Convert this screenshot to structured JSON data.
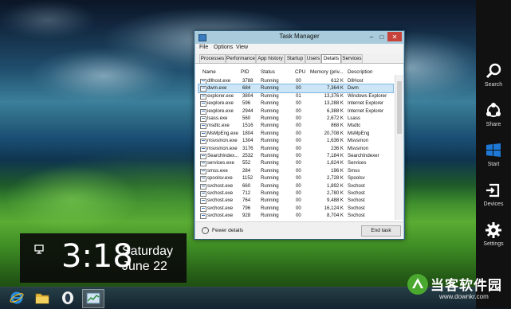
{
  "task_manager": {
    "title": "Task Manager",
    "menu": [
      "File",
      "Options",
      "View"
    ],
    "tabs": [
      {
        "label": "Processes",
        "selected": false
      },
      {
        "label": "Performance",
        "selected": false
      },
      {
        "label": "App history",
        "selected": false
      },
      {
        "label": "Startup",
        "selected": false
      },
      {
        "label": "Users",
        "selected": false
      },
      {
        "label": "Details",
        "selected": true
      },
      {
        "label": "Services",
        "selected": false
      }
    ],
    "columns": [
      "Name",
      "PID",
      "Status",
      "CPU",
      "Memory (priv...",
      "Description"
    ],
    "rows": [
      {
        "name": "dllhost.exe",
        "pid": "3788",
        "status": "Running",
        "cpu": "00",
        "memory": "612 K",
        "description": "DllHost"
      },
      {
        "name": "dwm.exe",
        "pid": "684",
        "status": "Running",
        "cpu": "00",
        "memory": "7,364 K",
        "description": "Dwm",
        "selected": true
      },
      {
        "name": "explorer.exe",
        "pid": "3804",
        "status": "Running",
        "cpu": "01",
        "memory": "13,376 K",
        "description": "Windows Explorer"
      },
      {
        "name": "iexplore.exe",
        "pid": "596",
        "status": "Running",
        "cpu": "00",
        "memory": "13,288 K",
        "description": "Internet Explorer"
      },
      {
        "name": "iexplore.exe",
        "pid": "2944",
        "status": "Running",
        "cpu": "00",
        "memory": "6,388 K",
        "description": "Internet Explorer"
      },
      {
        "name": "lsass.exe",
        "pid": "560",
        "status": "Running",
        "cpu": "00",
        "memory": "2,672 K",
        "description": "Lsass"
      },
      {
        "name": "msdtc.exe",
        "pid": "1516",
        "status": "Running",
        "cpu": "00",
        "memory": "868 K",
        "description": "Msdtc"
      },
      {
        "name": "MsMpEng.exe",
        "pid": "1804",
        "status": "Running",
        "cpu": "00",
        "memory": "20,708 K",
        "description": "MsMpEng"
      },
      {
        "name": "msvsmon.exe",
        "pid": "1304",
        "status": "Running",
        "cpu": "00",
        "memory": "1,636 K",
        "description": "Msvsmon"
      },
      {
        "name": "msvsmon.exe",
        "pid": "3176",
        "status": "Running",
        "cpu": "00",
        "memory": "236 K",
        "description": "Msvsmon"
      },
      {
        "name": "SearchIndex...",
        "pid": "2532",
        "status": "Running",
        "cpu": "00",
        "memory": "7,184 K",
        "description": "SearchIndexer"
      },
      {
        "name": "services.exe",
        "pid": "552",
        "status": "Running",
        "cpu": "00",
        "memory": "1,824 K",
        "description": "Services"
      },
      {
        "name": "smss.exe",
        "pid": "284",
        "status": "Running",
        "cpu": "00",
        "memory": "196 K",
        "description": "Smss"
      },
      {
        "name": "spoolsv.exe",
        "pid": "1152",
        "status": "Running",
        "cpu": "00",
        "memory": "2,728 K",
        "description": "Spoolsv"
      },
      {
        "name": "svchost.exe",
        "pid": "660",
        "status": "Running",
        "cpu": "00",
        "memory": "1,892 K",
        "description": "Svchost"
      },
      {
        "name": "svchost.exe",
        "pid": "712",
        "status": "Running",
        "cpu": "00",
        "memory": "2,780 K",
        "description": "Svchost"
      },
      {
        "name": "svchost.exe",
        "pid": "764",
        "status": "Running",
        "cpu": "00",
        "memory": "9,488 K",
        "description": "Svchost"
      },
      {
        "name": "svchost.exe",
        "pid": "796",
        "status": "Running",
        "cpu": "00",
        "memory": "16,124 K",
        "description": "Svchost"
      },
      {
        "name": "svchost.exe",
        "pid": "928",
        "status": "Running",
        "cpu": "00",
        "memory": "8,704 K",
        "description": "Svchost"
      }
    ],
    "fewer_details": "Fewer details",
    "end_task": "End task"
  },
  "charms": [
    {
      "label": "Search",
      "icon": "search-icon"
    },
    {
      "label": "Share",
      "icon": "share-icon"
    },
    {
      "label": "Start",
      "icon": "windows-logo-icon"
    },
    {
      "label": "Devices",
      "icon": "devices-icon"
    },
    {
      "label": "Settings",
      "icon": "gear-icon"
    }
  ],
  "clock": {
    "time": "3:18",
    "day": "Saturday",
    "date": "June 22"
  },
  "taskbar": [
    "internet-explorer-icon",
    "file-explorer-icon",
    "opera-icon",
    "task-manager-icon"
  ],
  "watermark": {
    "text": "当客软件园",
    "url": "www.downkr.com"
  },
  "colors": {
    "accent": "#1e78d6",
    "charms_bg": "#111111",
    "selection": "#cde6f7"
  }
}
